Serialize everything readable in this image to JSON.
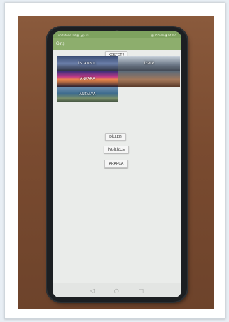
{
  "app": {
    "title": "Giriş"
  },
  "status_bar": {
    "left": "vodafone TR ▩ ◢ ▷ ⊡",
    "right": "▩ ✆ 53% ▮ 14:07"
  },
  "buttons": {
    "discover": "KEŞFET !",
    "languages": "DİLLER",
    "english": "İNGİLİZCE",
    "arabic": "ARAPÇA"
  },
  "cities": [
    {
      "label": "İSTANBUL"
    },
    {
      "label": "İZMİR"
    },
    {
      "label": "ANKARA"
    },
    {
      "label": ""
    },
    {
      "label": "ANTALYA"
    }
  ],
  "nav": {
    "back": "◁",
    "home": "○",
    "recents": "□"
  }
}
